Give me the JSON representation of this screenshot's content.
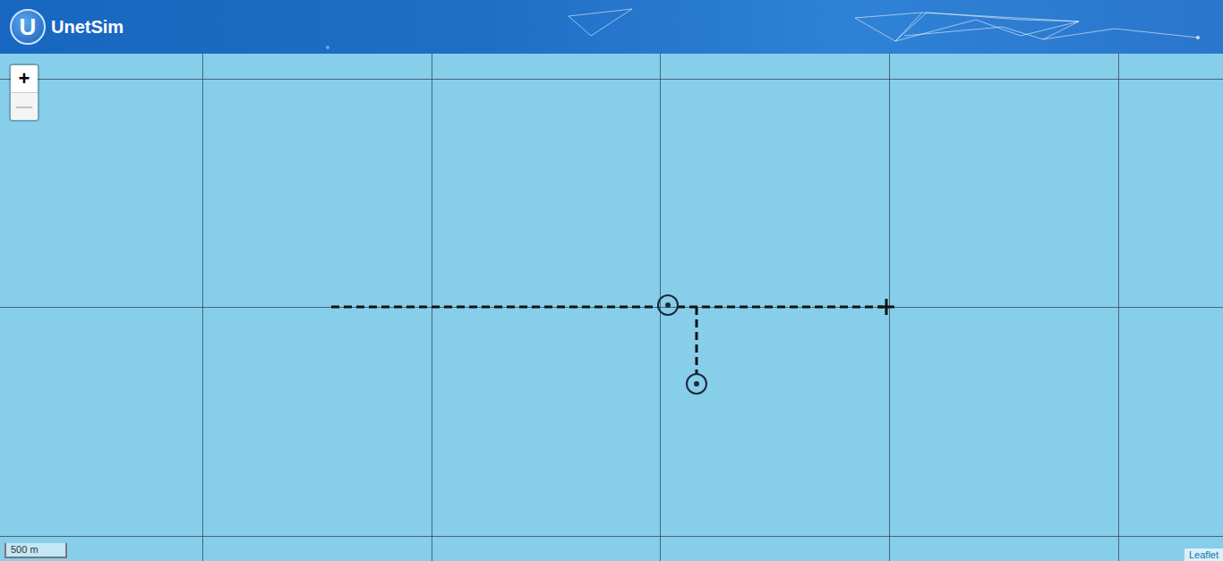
{
  "header": {
    "logo": "U",
    "title": "UnetSim"
  },
  "zoom": [
    {
      "label": "+",
      "disabled": false
    },
    {
      "label": "—",
      "disabled": true
    }
  ],
  "scale": {
    "label": "500 m"
  },
  "attribution": "Leaflet"
}
